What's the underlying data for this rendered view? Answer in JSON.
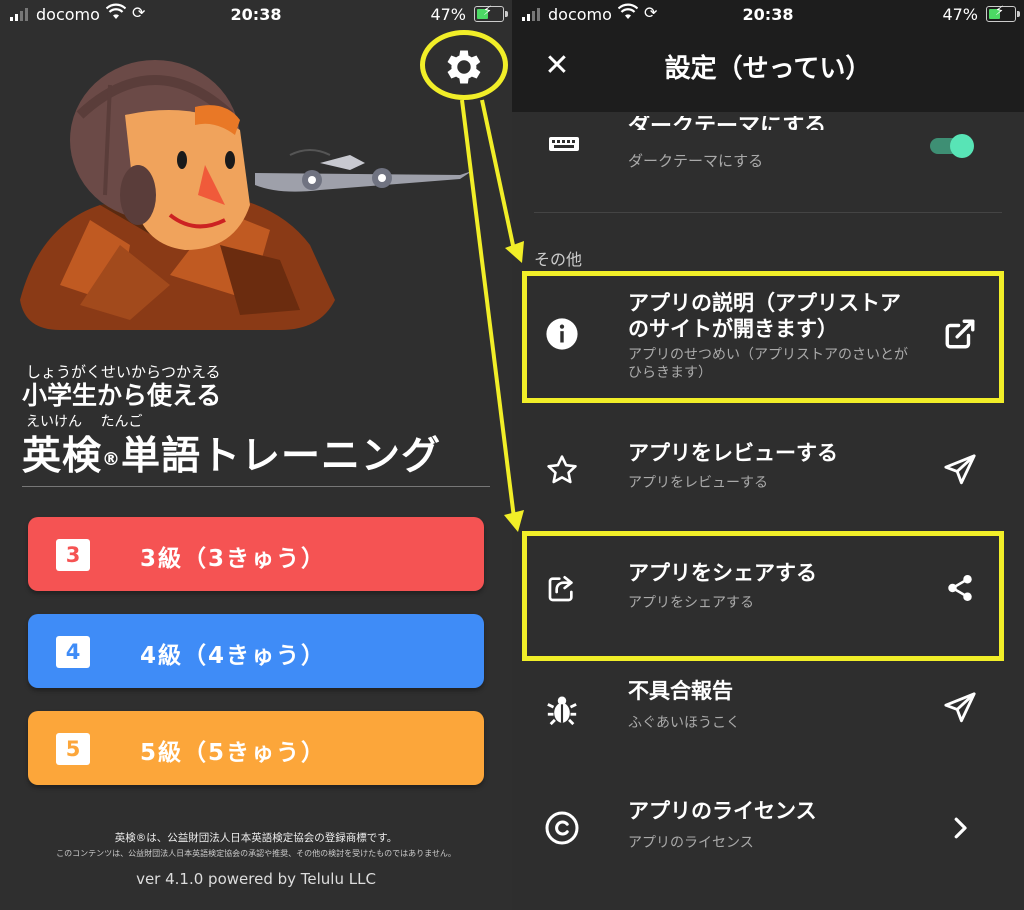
{
  "status_bar": {
    "carrier": "docomo",
    "time": "20:38",
    "battery": "47%"
  },
  "home": {
    "subtitle_ruby": "しょうがくせいからつかえる",
    "subtitle": "小学生から使える",
    "title_ruby": "えいけん たんご",
    "title_part1": "英検",
    "title_reg": "®",
    "title_part2": "単語トレーニング",
    "levels": [
      {
        "num": "3",
        "label": "3級（3きゅう）",
        "color": "#f55353"
      },
      {
        "num": "4",
        "label": "4級（4きゅう）",
        "color": "#3f8cf7"
      },
      {
        "num": "5",
        "label": "5級（5きゅう）",
        "color": "#fca63a"
      }
    ],
    "trademark_note": "英検®は、公益財団法人日本英語検定協会の登録商標です。",
    "content_note": "このコンテンツは、公益財団法人日本英語検定協会の承認や推奨、その他の検討を受けたものではありません。",
    "version": "ver 4.1.0 powered by Telulu LLC"
  },
  "settings": {
    "title": "設定（せってい）",
    "dark_theme": {
      "title": "ダークテーマにする",
      "subtitle": "ダークテーマにする",
      "enabled": true
    },
    "section_other": "その他",
    "items": [
      {
        "title": "アプリの説明（アプリストアのサイトが開きます）",
        "subtitle": "アプリのせつめい（アプリストアのさいとがひらきます）",
        "icon": "info-icon",
        "action_icon": "external-link-icon"
      },
      {
        "title": "アプリをレビューする",
        "subtitle": "アプリをレビューする",
        "icon": "star-icon",
        "action_icon": "send-icon"
      },
      {
        "title": "アプリをシェアする",
        "subtitle": "アプリをシェアする",
        "icon": "share-box-icon",
        "action_icon": "share-icon"
      },
      {
        "title": "不具合報告",
        "subtitle": "ふぐあいほうこく",
        "icon": "bug-icon",
        "action_icon": "send-icon"
      },
      {
        "title": "アプリのライセンス",
        "subtitle": "アプリのライセンス",
        "icon": "copyright-icon",
        "action_icon": "chevron-right-icon"
      }
    ]
  },
  "colors": {
    "highlight": "#f1ee28",
    "background": "#2f2f2f",
    "toggle_on": "#58e4b6"
  }
}
